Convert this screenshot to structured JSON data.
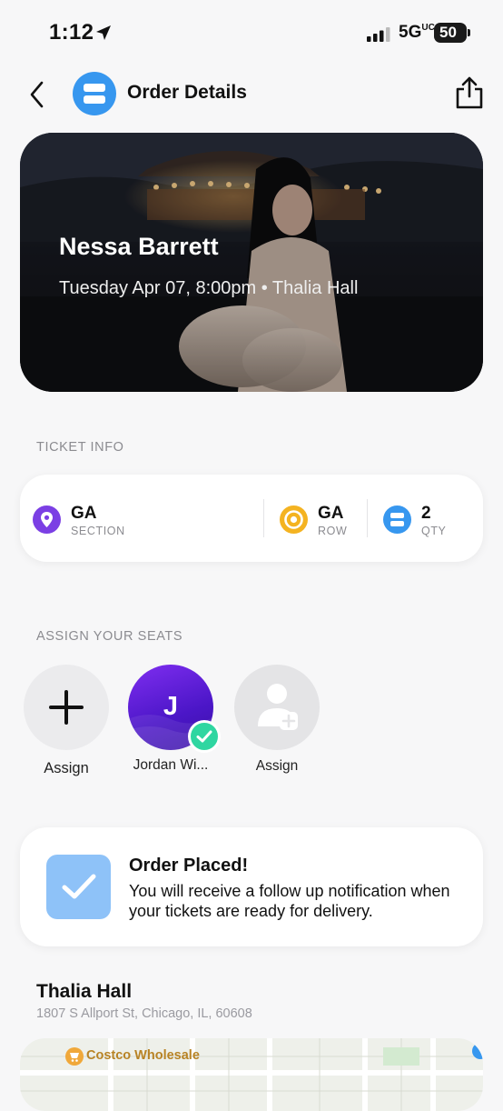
{
  "status_bar": {
    "time": "1:12",
    "network": "5G",
    "network_suffix": "UC",
    "battery": "50"
  },
  "header": {
    "title": "Order Details",
    "back_icon": "chevron-left-icon",
    "share_icon": "share-icon"
  },
  "event": {
    "artist": "Nessa Barrett",
    "date_venue": "Tuesday Apr 07, 8:00pm • Thalia Hall"
  },
  "ticket_info": {
    "label": "TICKET INFO",
    "items": [
      {
        "value": "GA",
        "sub": "SECTION",
        "icon": "location-pin-icon",
        "color": "#7b3fe4"
      },
      {
        "value": "GA",
        "sub": "ROW",
        "icon": "target-icon",
        "color": "#f4b321"
      },
      {
        "value": "2",
        "sub": "QTY",
        "icon": "ticket-icon",
        "color": "#3797ef"
      }
    ]
  },
  "assign": {
    "label": "ASSIGN YOUR SEATS",
    "seats": [
      {
        "label": "Assign",
        "state": "add"
      },
      {
        "label": "Jordan Wi...",
        "initial": "J",
        "state": "assigned"
      },
      {
        "label": "Assign",
        "state": "empty"
      }
    ]
  },
  "order": {
    "title": "Order Placed!",
    "message": "You will receive a follow up notification when your tickets are ready for delivery."
  },
  "venue": {
    "name": "Thalia Hall",
    "address": "1807 S Allport St, Chicago, IL, 60608"
  },
  "map": {
    "poi_label": "Costco Wholesale",
    "poi_icon": "shopping-cart-icon"
  },
  "colors": {
    "accent": "#3797ef",
    "purple": "#7b3fe4",
    "gold": "#f4b321",
    "green": "#2fd6a1"
  }
}
